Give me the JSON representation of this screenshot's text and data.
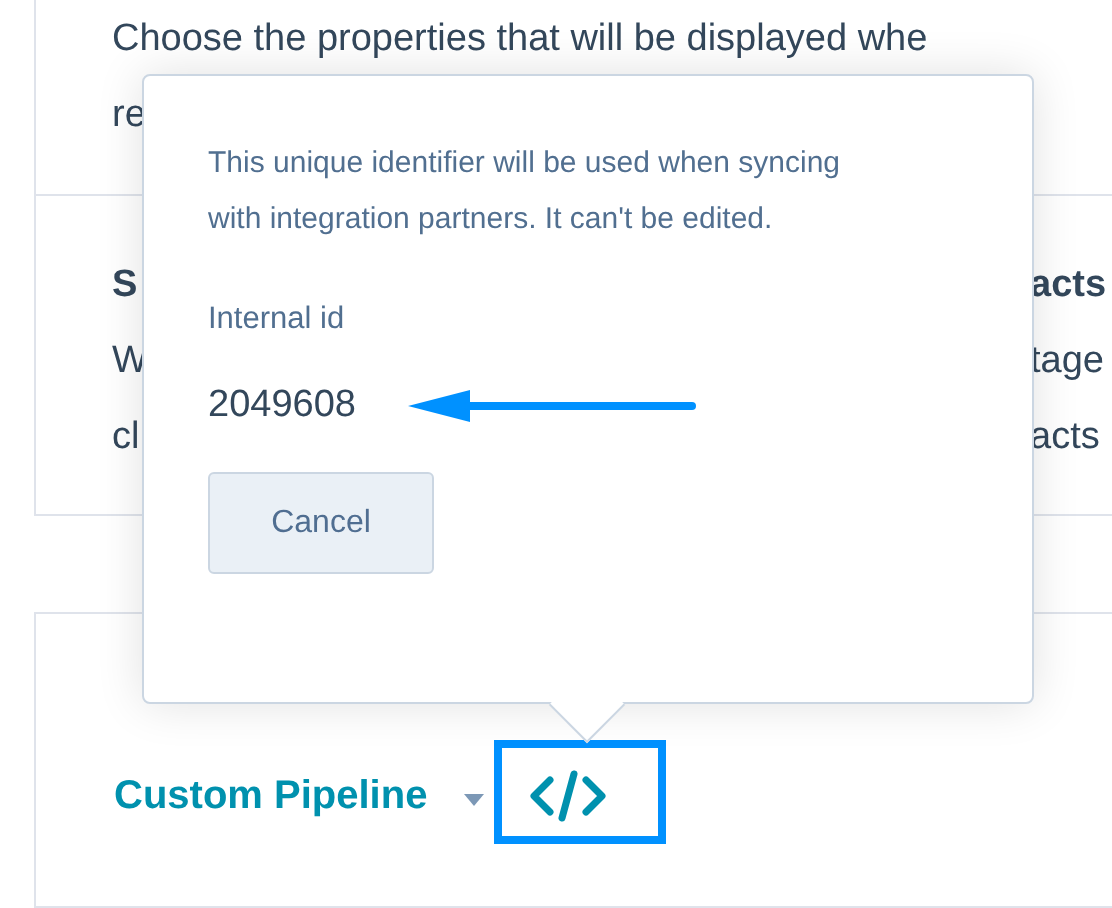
{
  "background": {
    "intro_lines": [
      "Choose the properties that will be displayed whe",
      "re"
    ],
    "section": {
      "heading_left": "S",
      "heading_right": "acts",
      "lines": [
        {
          "left": "W",
          "right": "tage"
        },
        {
          "left": "cl",
          "right": "acts"
        }
      ]
    },
    "pipeline": {
      "name": "Custom Pipeline"
    }
  },
  "popover": {
    "description": "This unique identifier will be used when syncing with integration partners. It can't be edited.",
    "field_label": "Internal id",
    "field_value": "2049608",
    "buttons": [
      "Cancel"
    ]
  }
}
